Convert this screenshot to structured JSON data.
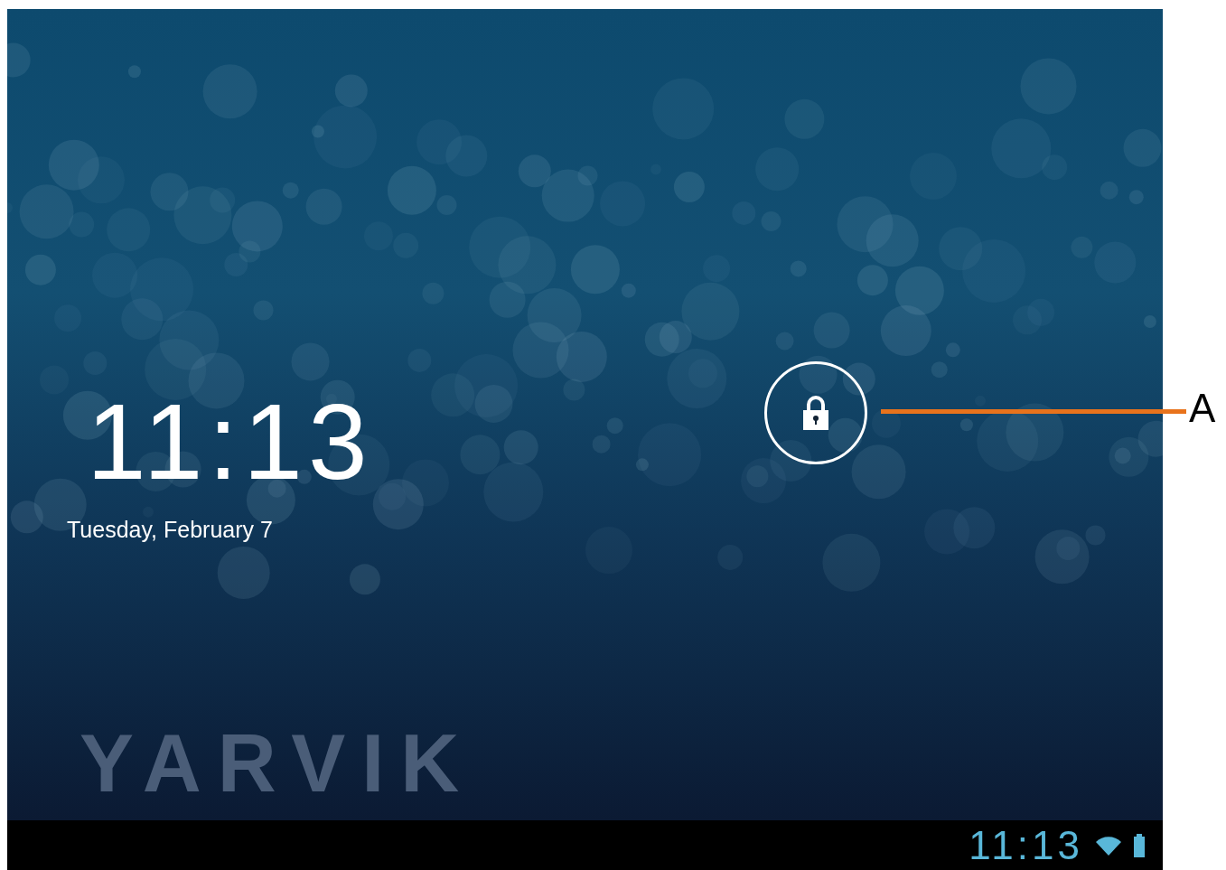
{
  "lock_screen": {
    "time": "11:13",
    "date": "Tuesday, February 7",
    "wallpaper_logo": "YARVIK"
  },
  "status_bar": {
    "time": "11:13"
  },
  "callout": {
    "label": "A"
  }
}
